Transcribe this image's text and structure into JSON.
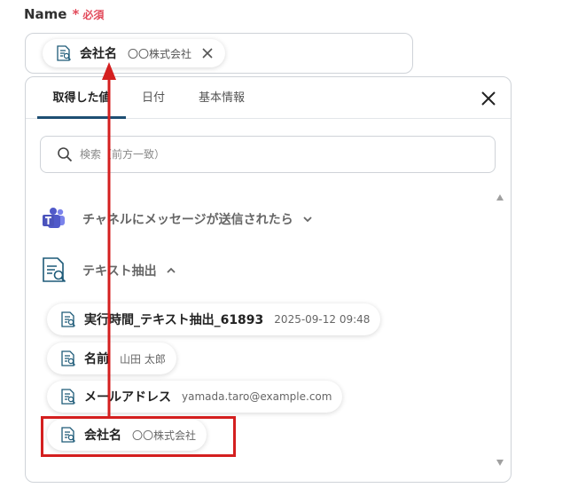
{
  "field": {
    "label": "Name",
    "required_star": "*",
    "required_text": "必須"
  },
  "input_chip": {
    "label": "会社名",
    "value": "〇〇株式会社"
  },
  "tabs": [
    {
      "label": "取得した値",
      "active": true
    },
    {
      "label": "日付",
      "active": false
    },
    {
      "label": "基本情報",
      "active": false
    }
  ],
  "search": {
    "placeholder": "検索（前方一致）",
    "value": ""
  },
  "sections": [
    {
      "label": "チャネルにメッセージが送信されたら",
      "icon": "teams-icon",
      "expanded": false
    },
    {
      "label": "テキスト抽出",
      "icon": "document-search-icon",
      "expanded": true
    }
  ],
  "items": [
    {
      "label": "実行時間_テキスト抽出_61893",
      "value": "2025-09-12 09:48"
    },
    {
      "label": "名前",
      "value": "山田 太郎"
    },
    {
      "label": "メールアドレス",
      "value": "yamada.taro@example.com"
    },
    {
      "label": "会社名",
      "value": "〇〇株式会社"
    }
  ],
  "colors": {
    "accent": "#1e4e73",
    "required": "#e24a5b",
    "annotation": "#d41f1f",
    "icon": "#1d5a78"
  }
}
